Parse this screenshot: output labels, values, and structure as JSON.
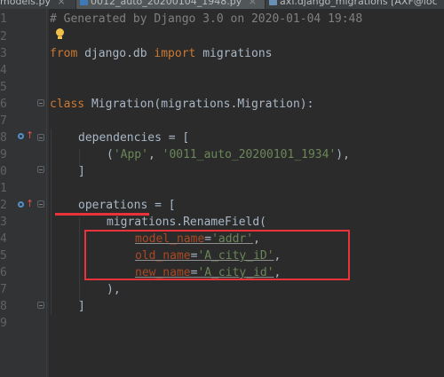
{
  "tabs": [
    {
      "label": "models.py",
      "active": false
    },
    {
      "label": "0012_auto_20200104_1948.py",
      "active": true
    },
    {
      "label": "axf.django_migrations [AXF@loc",
      "active": false
    }
  ],
  "tab_close": "×",
  "line_numbers": [
    "1",
    "2",
    "3",
    "4",
    "5",
    "6",
    "7",
    "8",
    "9",
    "0",
    "1",
    "2",
    "3",
    "4",
    "5",
    "6",
    "7",
    "8",
    "9"
  ],
  "code": {
    "l1": {
      "comment": "# Generated by Django 3.0 on 2020-01-04 19:48"
    },
    "l3": {
      "kw_from": "from",
      "mod": " django.db ",
      "kw_import": "import",
      "name": " migrations"
    },
    "l6": {
      "kw_class": "class",
      "rest": " Migration(migrations.Migration):"
    },
    "l8": {
      "name": "dependencies",
      "rest": " = ["
    },
    "l9": {
      "open": "(",
      "s1": "'App'",
      "mid": ", ",
      "s2": "'0011_auto_20200101_1934'",
      "close": "),"
    },
    "l10": {
      "text": "]"
    },
    "l12": {
      "name": "operations",
      "rest": " = ["
    },
    "l13": {
      "text": "migrations.RenameField("
    },
    "l14": {
      "param": "model_name",
      "eq": "=",
      "val": "'addr'",
      "comma": ","
    },
    "l15": {
      "param": "old_name",
      "eq": "=",
      "val": "'A_city_iD'",
      "comma": ","
    },
    "l16": {
      "param": "new_name",
      "eq": "=",
      "val": "'A_city_id'",
      "comma": ","
    },
    "l17": {
      "text": "),"
    },
    "l18": {
      "text": "]"
    }
  },
  "colors": {
    "keyword": "#cc7832",
    "string": "#6a8759",
    "param": "#aa4926",
    "comment": "#808080",
    "annotation": "#e8333a"
  }
}
